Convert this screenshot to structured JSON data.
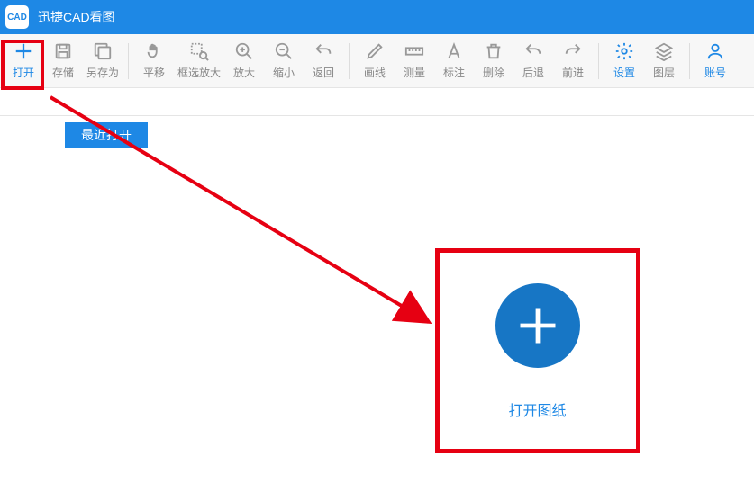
{
  "titlebar": {
    "app_icon_text": "CAD",
    "title": "迅捷CAD看图"
  },
  "toolbar": {
    "open": "打开",
    "save": "存储",
    "saveas": "另存为",
    "pan": "平移",
    "boxzoom": "框选放大",
    "zoomin": "放大",
    "zoomout": "缩小",
    "return": "返回",
    "drawline": "画线",
    "measure": "测量",
    "annotate": "标注",
    "delete": "删除",
    "undo": "后退",
    "redo": "前进",
    "settings": "设置",
    "layers": "图层",
    "account": "账号"
  },
  "content": {
    "recent_tab": "最近打开",
    "open_drawing": "打开图纸"
  },
  "colors": {
    "brand": "#1e88e5",
    "highlight": "#e60012"
  }
}
